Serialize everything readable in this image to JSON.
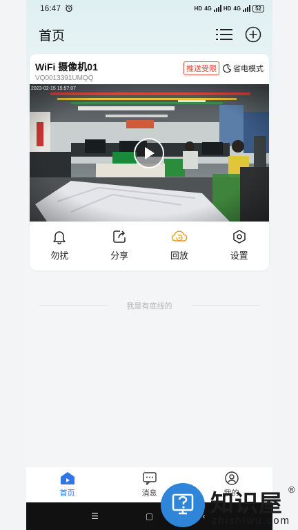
{
  "status_bar": {
    "time": "16:47",
    "network_1": "HD",
    "signal_1": "4G",
    "network_2": "HD",
    "signal_2": "4G",
    "battery": "52"
  },
  "header": {
    "title": "首页"
  },
  "camera": {
    "name": "WiFi 摄像机01",
    "device_id": "VQ0013391UMQQ",
    "push_badge": "推送受限",
    "mode_label": "省电模式",
    "timestamp": "2023-02-15 15:57:07"
  },
  "actions": [
    {
      "label": "勿扰",
      "icon": "bell-icon"
    },
    {
      "label": "分享",
      "icon": "share-icon"
    },
    {
      "label": "回放",
      "icon": "cloud-playback-icon"
    },
    {
      "label": "设置",
      "icon": "settings-hexagon-icon"
    }
  ],
  "footer": {
    "text": "我是有底线的"
  },
  "tabbar": [
    {
      "label": "首页",
      "active": true
    },
    {
      "label": "消息",
      "active": false
    },
    {
      "label": "我的",
      "active": false
    }
  ],
  "watermark": {
    "title": "知识屋",
    "reg": "®",
    "url": "zhishiwu.com"
  },
  "colors": {
    "accent": "#2e75e8",
    "warning": "#e0463a",
    "playback": "#e8a020",
    "header_bg": "#dff0f2"
  }
}
